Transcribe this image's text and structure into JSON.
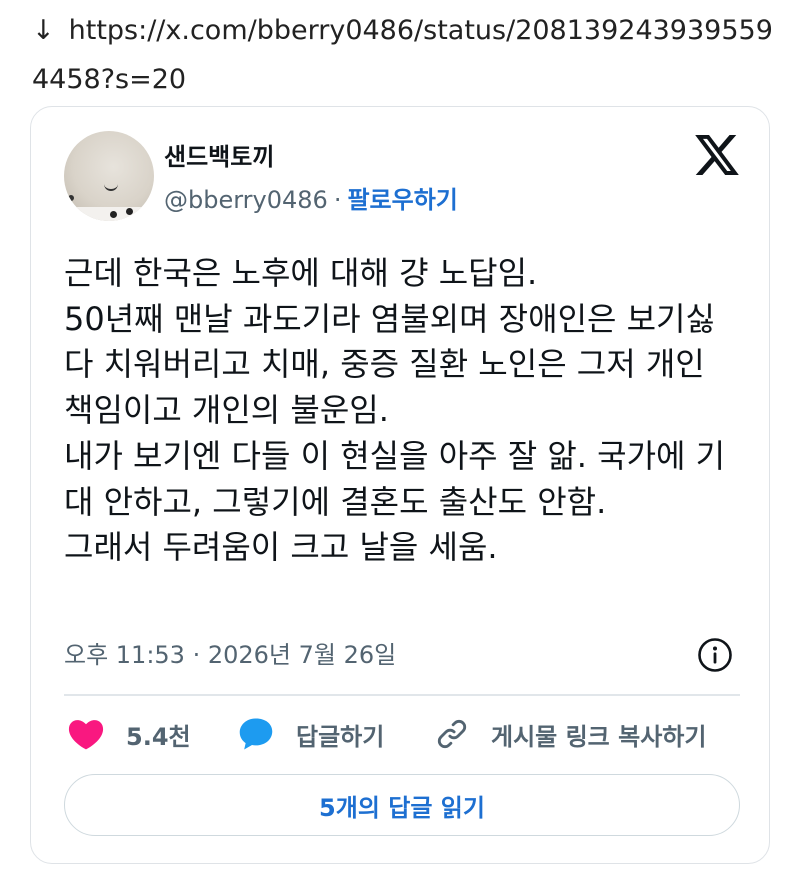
{
  "url_bar": {
    "arrow": "↓",
    "url": "https://x.com/bberry0486/status/2081392439395594458?s=20"
  },
  "tweet": {
    "display_name": "샌드백토끼",
    "handle": "@bberry0486",
    "separator": "·",
    "follow_label": "팔로우하기",
    "logo_icon": "x-logo-icon",
    "text_lines": [
      "근데 한국은 노후에 대해 걍 노답임.",
      "50년째 맨날 과도기라 염불외며 장애인은 보기싫다 치워버리고 치매, 중증 질환 노인은 그저 개인 책임이고 개인의 불운임.",
      "내가 보기엔 다들 이 현실을 아주 잘 앎. 국가에 기대 안하고, 그렇기에 결혼도 출산도 안함.",
      "그래서 두려움이 크고 날을 세움."
    ],
    "timestamp": "오후 11:53 · 2026년 7월 26일",
    "info_icon": "info-icon",
    "actions": {
      "like_count": "5.4천",
      "like_icon": "heart-icon",
      "reply_label": "답글하기",
      "reply_icon": "speech-bubble-icon",
      "copy_label": "게시물 링크 복사하기",
      "copy_icon": "link-icon"
    },
    "read_replies_label": "5개의 답글 읽기"
  },
  "colors": {
    "accent_blue": "#1d6fd1",
    "heart_pink": "#f91880",
    "reply_blue": "#1d9bf0",
    "muted_text": "#536471",
    "border": "#dfe3e7"
  }
}
